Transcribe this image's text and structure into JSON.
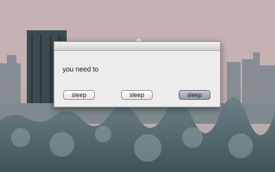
{
  "dialog": {
    "message": "you need to",
    "buttons": [
      {
        "label": "sleep"
      },
      {
        "label": "sleep"
      },
      {
        "label": "sleep",
        "default": true
      }
    ]
  },
  "colors": {
    "sky_top": "#c9b5b7",
    "sky_bottom": "#b4aeae",
    "dialog_bg": "#ececec",
    "default_button": "#9aa0ab"
  }
}
